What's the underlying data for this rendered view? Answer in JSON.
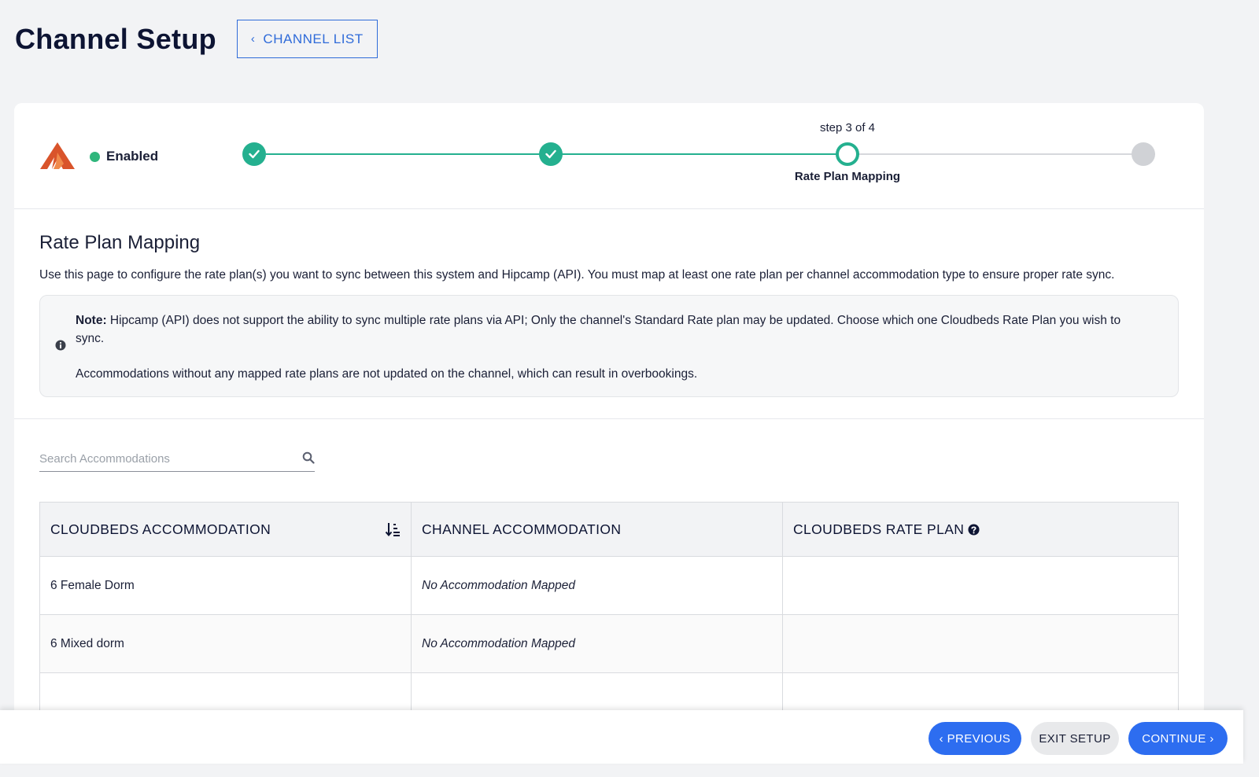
{
  "header": {
    "title": "Channel Setup",
    "channel_list_label": "CHANNEL LIST"
  },
  "status": {
    "label": "Enabled",
    "color": "#2fb67c"
  },
  "stepper": {
    "caption": "step 3 of 4",
    "current_step": 3,
    "total_steps": 4,
    "current_name": "Rate Plan Mapping",
    "done_color": "#24b08f",
    "todo_color": "#d0d2d6"
  },
  "section": {
    "title": "Rate Plan Mapping",
    "description": "Use this page to configure the rate plan(s) you want to sync between this system and Hipcamp (API). You must map at least one rate plan per channel accommodation type to ensure proper rate sync.",
    "note_label": "Note:",
    "note_text": "Hipcamp (API) does not support the ability to sync multiple rate plans via API; Only the channel's Standard Rate plan may be updated. Choose which one Cloudbeds Rate Plan you wish to sync.",
    "note_text2": "Accommodations without any mapped rate plans are not updated on the channel, which can result in overbookings."
  },
  "search": {
    "placeholder": "Search Accommodations",
    "value": ""
  },
  "table": {
    "columns": [
      "CLOUDBEDS ACCOMMODATION",
      "CHANNEL ACCOMMODATION",
      "CLOUDBEDS RATE PLAN"
    ],
    "rows": [
      {
        "accommodation": "6 Female Dorm",
        "channel": "No Accommodation Mapped",
        "rate_plan": ""
      },
      {
        "accommodation": "6 Mixed dorm",
        "channel": "No Accommodation Mapped",
        "rate_plan": ""
      },
      {
        "accommodation": "",
        "channel": "",
        "rate_plan": ""
      }
    ]
  },
  "footer": {
    "previous_label": "‹ PREVIOUS",
    "exit_label": "EXIT SETUP",
    "continue_label": "CONTINUE ›",
    "primary_color": "#2d6df0"
  },
  "icons": {
    "brand": "hipcamp-logo",
    "back": "chevron-left-icon",
    "check": "check-icon",
    "info": "info-icon",
    "search": "search-icon",
    "sort": "sort-icon",
    "help": "help-icon"
  }
}
